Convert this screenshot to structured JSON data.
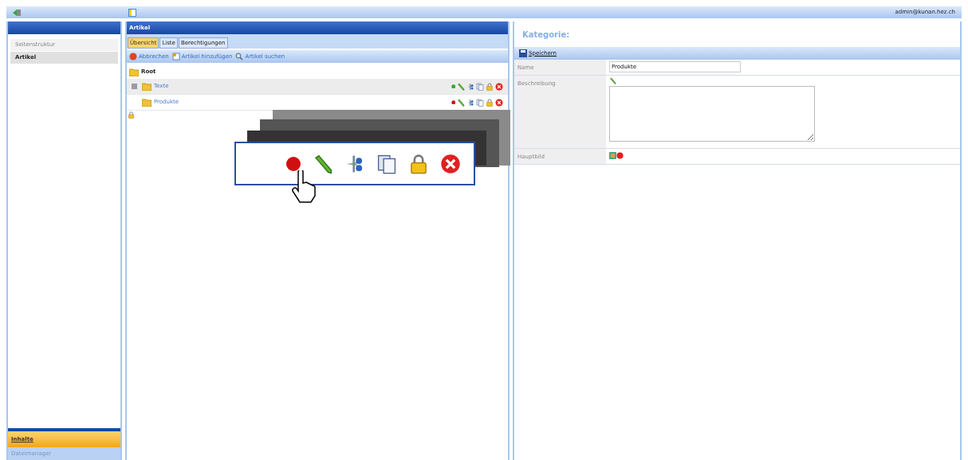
{
  "top_bar": {
    "user": "admin@kunan.hez.ch"
  },
  "sidebar": {
    "items": [
      {
        "label": "Seitenstruktur",
        "selected": false
      },
      {
        "label": "Artikel",
        "selected": true
      }
    ],
    "sections": [
      {
        "label": "Inhalte",
        "selected": true
      },
      {
        "label": "Dateimanager",
        "selected": false
      }
    ]
  },
  "articles": {
    "title": "Artikel",
    "tabs": [
      {
        "label": "Übersicht",
        "selected": true
      },
      {
        "label": "Liste",
        "selected": false
      },
      {
        "label": "Berechtigungen",
        "selected": false
      }
    ],
    "toolbar": [
      {
        "label": "Abbrechen",
        "kind": "cancel"
      },
      {
        "label": "Artikel hinzufügen",
        "kind": "add"
      },
      {
        "label": "Artikel suchen",
        "kind": "search"
      }
    ],
    "tree": {
      "label": "Root",
      "children": [
        {
          "label": "Texte",
          "expandable": true,
          "selected": true,
          "color": "#2fa82f"
        },
        {
          "label": "Produkte",
          "expandable": false,
          "selected": false,
          "color": "#d01010"
        }
      ]
    }
  },
  "detail": {
    "title": "Kategorie:",
    "save": "Speichern",
    "fields": [
      {
        "label": "Name",
        "kind": "text",
        "value": "Produkte"
      },
      {
        "label": "Beschreibung",
        "kind": "textarea"
      },
      {
        "label": "Hauptbild",
        "kind": "image"
      }
    ]
  }
}
